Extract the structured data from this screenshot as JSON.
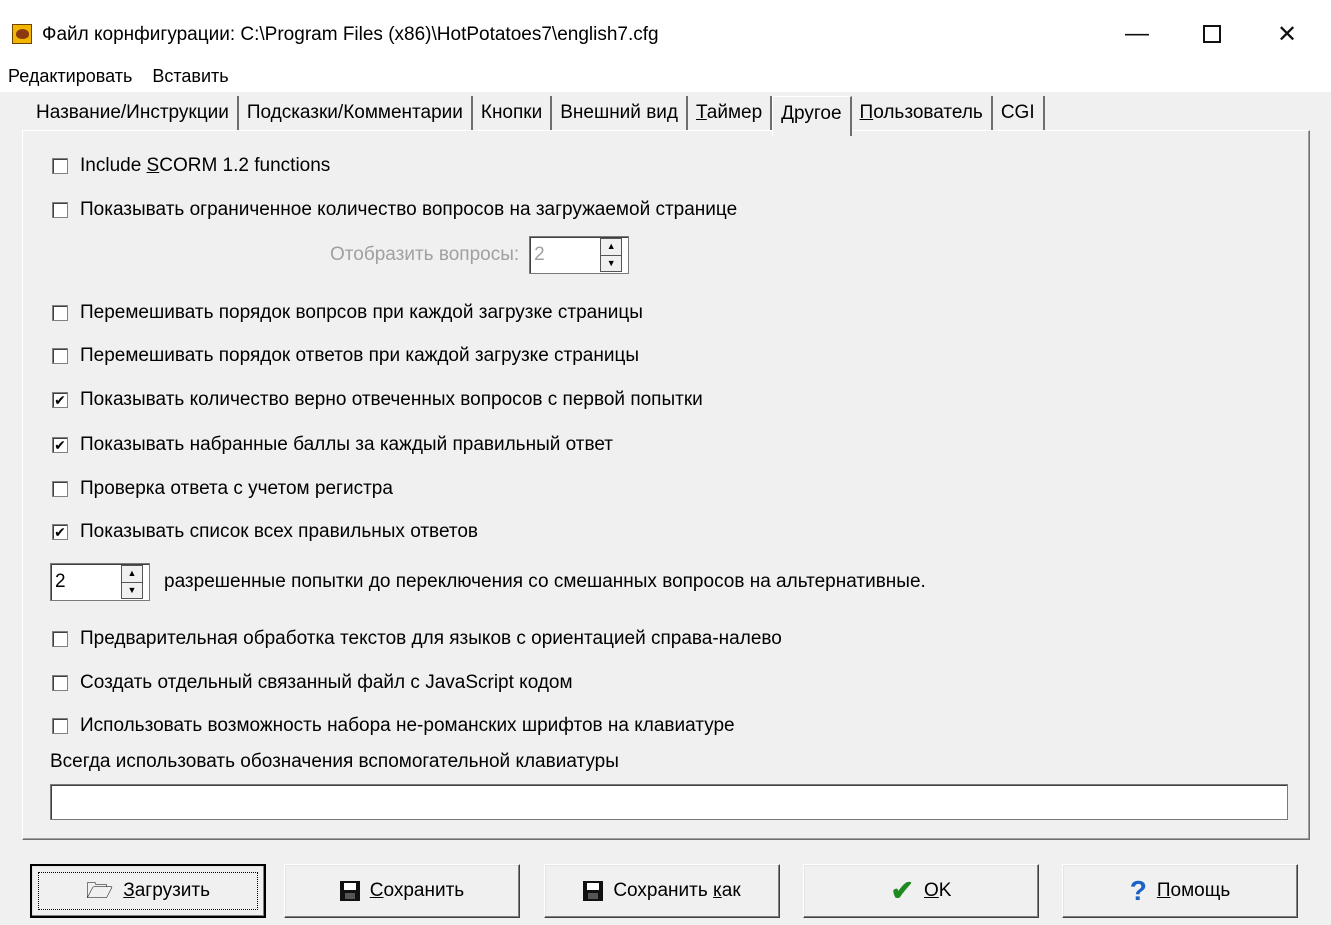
{
  "window": {
    "title": "Файл корнфигурации: C:\\Program Files (x86)\\HotPotatoes7\\english7.cfg",
    "controls": {
      "minimize": "—",
      "close": "✕"
    }
  },
  "menu": [
    "Редактировать",
    "Вставить"
  ],
  "tabs": [
    {
      "label": "Название/Инструкции",
      "active": false
    },
    {
      "label": "Подсказки/Комментарии",
      "active": false
    },
    {
      "label": "Кнопки",
      "active": false
    },
    {
      "label": "Внешний вид",
      "active": false
    },
    {
      "label": "Таймер",
      "active": false
    },
    {
      "label": "Другое",
      "active": true
    },
    {
      "label": "Пользователь",
      "active": false
    },
    {
      "label": "CGI",
      "active": false
    }
  ],
  "options": {
    "scorm": {
      "label": "Include SCORM 1.2 functions",
      "checked": false
    },
    "limit_questions": {
      "label": "Показывать ограниченное количество вопросов на загружаемой странице",
      "checked": false
    },
    "display_questions": {
      "label": "Отобразить вопросы:",
      "value": "2"
    },
    "shuffle_questions": {
      "label": "Перемешивать порядок вопрсов при каждой загрузке страницы",
      "checked": false
    },
    "shuffle_answers": {
      "label": "Перемешивать порядок ответов при каждой загрузке страницы",
      "checked": false
    },
    "show_first_try": {
      "label": "Показывать количество верно отвеченных вопросов с первой попытки",
      "checked": true
    },
    "show_points": {
      "label": "Показывать набранные баллы за каждый правильный ответ",
      "checked": true
    },
    "case_sensitive": {
      "label": "Проверка ответа с учетом регистра",
      "checked": false
    },
    "show_all_answers": {
      "label": "Показывать список всех правильных ответов",
      "checked": true
    },
    "attempts": {
      "value": "2",
      "label": "разрешенные попытки до переключения со смешанных вопросов на альтернативные."
    },
    "rtl": {
      "label": "Предварительная обработка текстов для языков с ориентацией справа-налево",
      "checked": false
    },
    "separate_js": {
      "label": "Создать отдельный связанный файл с JavaScript кодом",
      "checked": false
    },
    "non_roman": {
      "label": "Использовать возможность набора не-романских шрифтов на клавиатуре",
      "checked": false
    },
    "keyboard_label": "Всегда использовать обозначения вспомогательной клавиатуры",
    "keyboard_value": ""
  },
  "buttons": {
    "load": "Загрузить",
    "save": "Сохранить",
    "save_as": "Сохранить как",
    "ok": "OK",
    "help": "Помощь"
  },
  "icons": {
    "folder": "🗁",
    "check": "✔",
    "help": "?"
  }
}
